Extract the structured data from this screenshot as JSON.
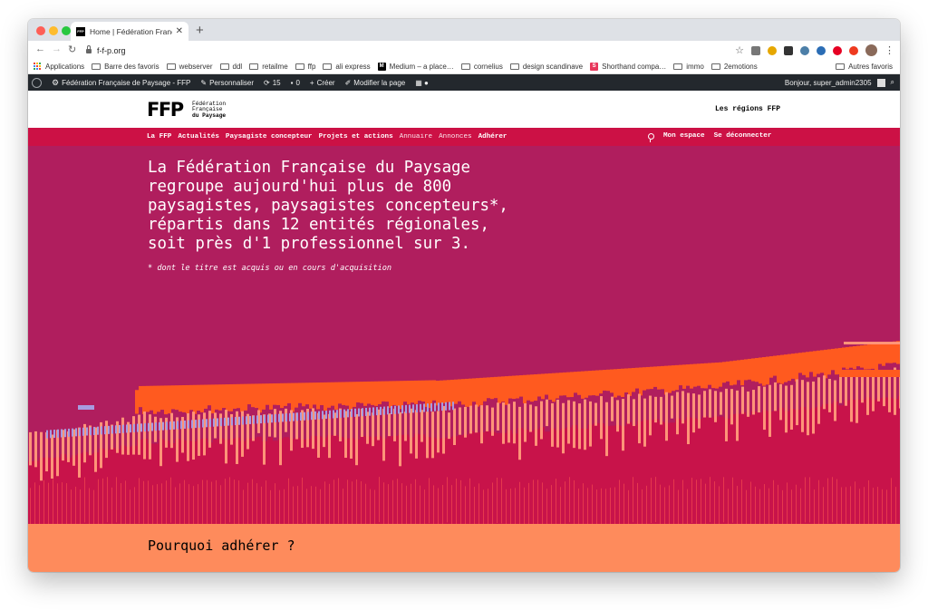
{
  "browser": {
    "tab_title": "Home | Fédération Française d…",
    "tab_favicon_text": "FFP",
    "new_tab_symbol": "+",
    "url": "f-f-p.org",
    "bookmarks": [
      {
        "label": "Applications",
        "icon": "apps-icon"
      },
      {
        "label": "Barre des favoris",
        "icon": "folder-icon"
      },
      {
        "label": "webserver",
        "icon": "folder-icon"
      },
      {
        "label": "ddl",
        "icon": "folder-icon"
      },
      {
        "label": "retailme",
        "icon": "folder-icon"
      },
      {
        "label": "ffp",
        "icon": "folder-icon"
      },
      {
        "label": "ali express",
        "icon": "folder-icon"
      },
      {
        "label": "Medium – a place…",
        "icon": "medium-icon"
      },
      {
        "label": "cornelius",
        "icon": "folder-icon"
      },
      {
        "label": "design scandinave",
        "icon": "folder-icon"
      },
      {
        "label": "Shorthand compa…",
        "icon": "shorthand-icon"
      },
      {
        "label": "immo",
        "icon": "folder-icon"
      },
      {
        "label": "2emotions",
        "icon": "folder-icon"
      }
    ],
    "other_bookmarks": "Autres favoris"
  },
  "wp_admin": {
    "site_name": "Fédération Française de Paysage - FFP",
    "customize": "Personnaliser",
    "updates_count": "15",
    "comments_count": "0",
    "new": "Créer",
    "edit_page": "Modifier la page",
    "greeting": "Bonjour, super_admin2305"
  },
  "site": {
    "logo_mark": "FFP",
    "logo_line1": "Fédération",
    "logo_line2": "Française",
    "logo_line3": "du Paysage",
    "regions_link": "Les régions FFP",
    "nav_left": [
      {
        "label": "La FFP",
        "weight": "bold"
      },
      {
        "label": "Actualités",
        "weight": "bold"
      },
      {
        "label": "Paysagiste concepteur",
        "weight": "bold"
      },
      {
        "label": "Projets et actions",
        "weight": "bold"
      },
      {
        "label": "Annuaire",
        "weight": "light"
      },
      {
        "label": "Annonces",
        "weight": "light"
      },
      {
        "label": "Adhérer",
        "weight": "bold"
      }
    ],
    "nav_right": {
      "my_space": "Mon espace",
      "logout": "Se déconnecter"
    }
  },
  "hero": {
    "lines": [
      "La Fédération Française du Paysage",
      "regroupe aujourd'hui plus de 800",
      "paysagistes, paysagistes concepteurs*,",
      "répartis dans 12 entités régionales,",
      "soit près d'1 professionnel sur 3."
    ],
    "footnote": "* dont le titre est acquis ou en cours d'acquisition"
  },
  "why_section": {
    "title": "Pourquoi adhérer ?"
  },
  "colors": {
    "hero_bg": "#b01e5e",
    "nav_bg": "#cc1145",
    "orange": "#ff5a1f",
    "salmon": "#ff9478",
    "crimson": "#c8134a",
    "lavender": "#a79be0",
    "bottom_bg": "#fe8b5c"
  }
}
